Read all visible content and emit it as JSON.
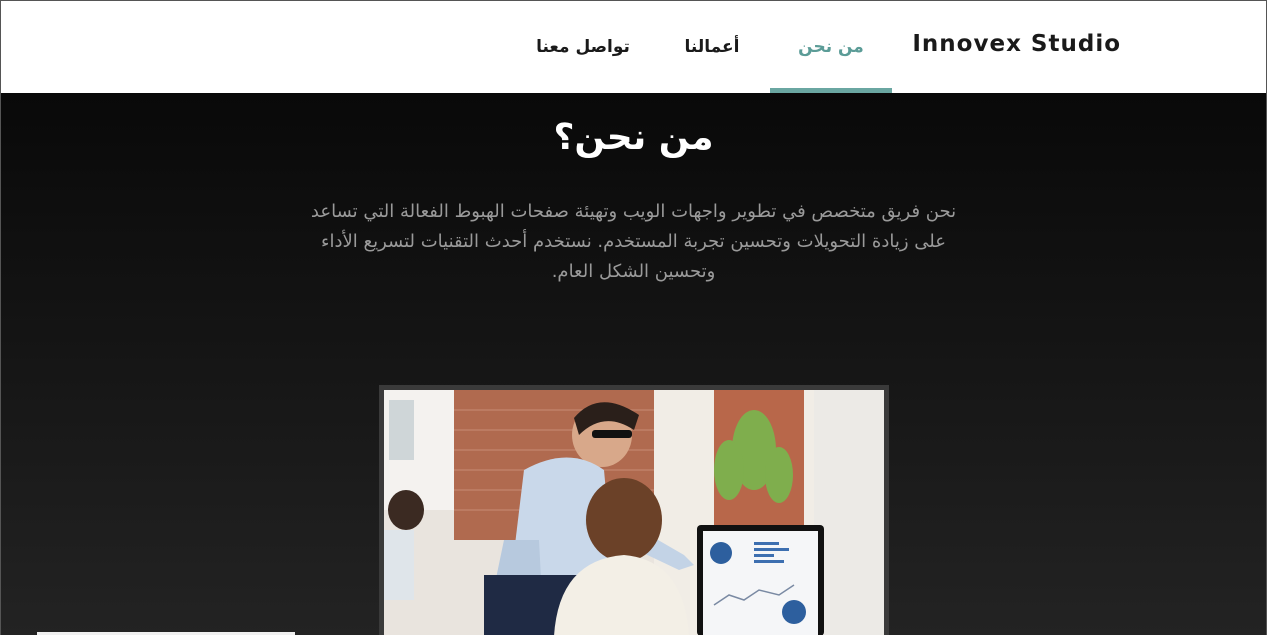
{
  "nav": {
    "brand": "Innovex Studio",
    "items": [
      {
        "label": "من نحن",
        "active": true
      },
      {
        "label": "أعمالنا",
        "active": false
      },
      {
        "label": "تواصل معنا",
        "active": false
      }
    ]
  },
  "hero": {
    "title": "من نحن؟",
    "paragraph": "نحن فريق متخصص في تطوير واجهات الويب وتهيئة صفحات الهبوط الفعالة التي تساعد على زيادة التحويلات وتحسين تجربة المستخدم. نستخدم أحدث التقنيات لتسريع الأداء وتحسين الشكل العام."
  },
  "colors": {
    "accent": "#6aa6a1",
    "active_text": "#5b9c97",
    "hero_bg_top": "#090909",
    "hero_bg_bottom": "#232323"
  }
}
